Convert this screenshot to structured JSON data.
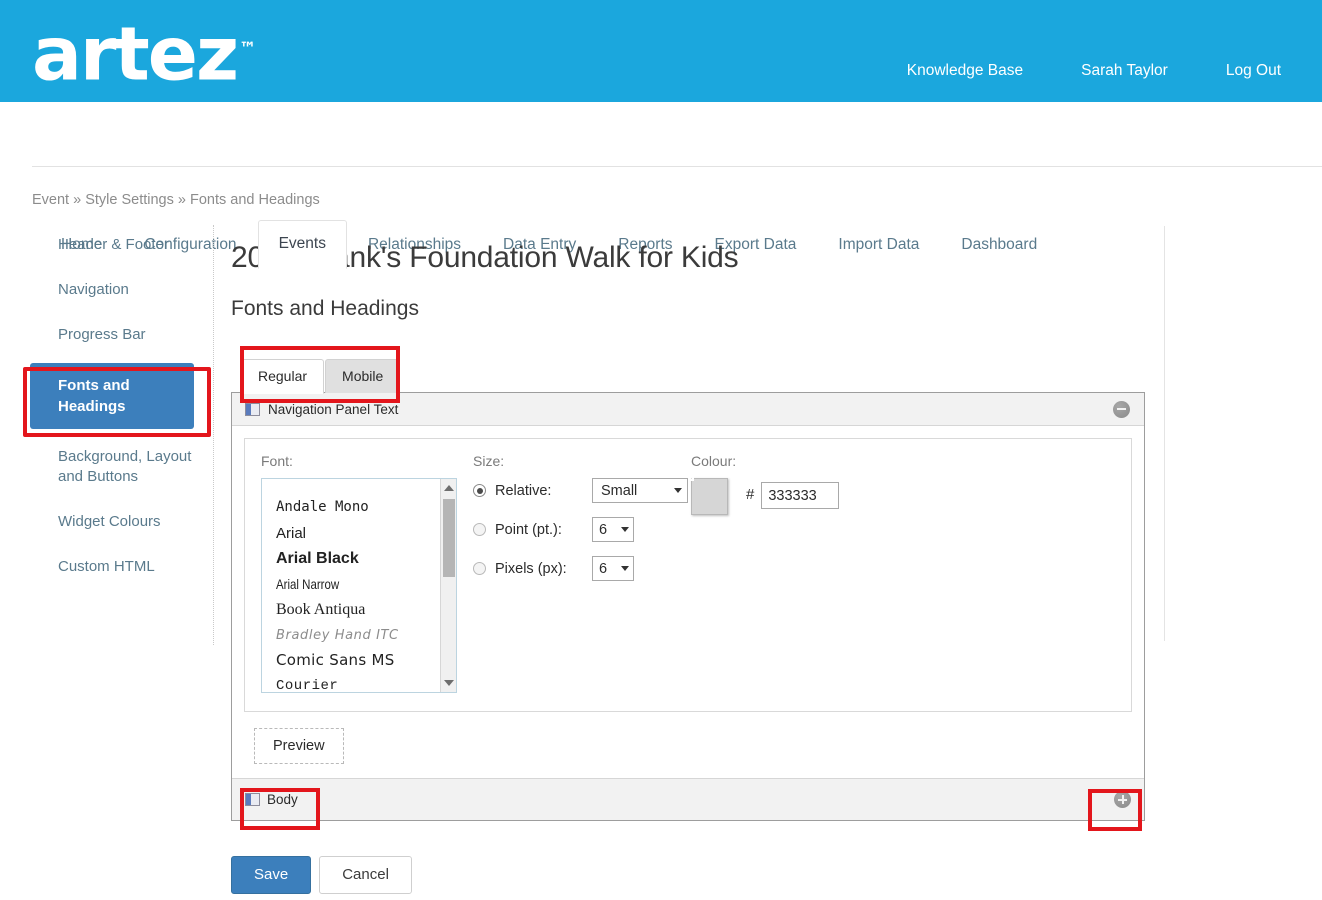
{
  "brand": {
    "logo_text": "artez",
    "logo_tm": "™",
    "links": [
      {
        "label": "Knowledge Base"
      },
      {
        "label": "Sarah Taylor"
      },
      {
        "label": "Log Out"
      }
    ],
    "header_color": "#1BA7DD"
  },
  "nav": {
    "tabs": [
      {
        "label": "Home",
        "active": false
      },
      {
        "label": "Configuration",
        "active": false
      },
      {
        "label": "Events",
        "active": true
      },
      {
        "label": "Relationships",
        "active": false
      },
      {
        "label": "Data Entry",
        "active": false
      },
      {
        "label": "Reports",
        "active": false
      },
      {
        "label": "Export Data",
        "active": false
      },
      {
        "label": "Import Data",
        "active": false
      },
      {
        "label": "Dashboard",
        "active": false
      }
    ]
  },
  "breadcrumb": {
    "text": "Event » Style Settings » Fonts and Headings"
  },
  "sidebar": {
    "items": [
      {
        "label": "Header & Footer",
        "active": false
      },
      {
        "label": "Navigation",
        "active": false
      },
      {
        "label": "Progress Bar",
        "active": false
      },
      {
        "label": "Fonts and Headings",
        "active": true
      },
      {
        "label": "Background, Layout and Buttons",
        "active": false
      },
      {
        "label": "Widget Colours",
        "active": false
      },
      {
        "label": "Custom HTML",
        "active": false
      }
    ],
    "active_color": "#3C7FBC"
  },
  "main": {
    "title": "2017 Frank's Foundation Walk for Kids",
    "subtitle": "Fonts and Headings",
    "view_tabs": [
      {
        "label": "Regular",
        "active": true
      },
      {
        "label": "Mobile",
        "active": false
      }
    ],
    "accordion": {
      "open_section": {
        "title": "Navigation Panel Text",
        "icon": "panel-icon",
        "toggle_icon": "minus-circle-icon"
      },
      "closed_section": {
        "title": "Body",
        "icon": "panel-icon",
        "toggle_icon": "plus-circle-icon"
      }
    },
    "font_field": {
      "label": "Font:",
      "options": [
        "Andale Mono",
        "Arial",
        "Arial Black",
        "Arial Narrow",
        "Book Antiqua",
        "Bradley Hand ITC",
        "Comic Sans MS",
        "Courier"
      ]
    },
    "size_field": {
      "label": "Size:",
      "rows": [
        {
          "label": "Relative:",
          "selected": true,
          "value": "Small"
        },
        {
          "label": "Point (pt.):",
          "selected": false,
          "value": "6"
        },
        {
          "label": "Pixels (px):",
          "selected": false,
          "value": "6"
        }
      ]
    },
    "colour_field": {
      "label": "Colour:",
      "hash": "#",
      "hex_value": "333333",
      "swatch_color": "#333333"
    },
    "preview_button": "Preview",
    "save_button": "Save",
    "cancel_button": "Cancel"
  },
  "annotations": {
    "color": "#E3161C",
    "boxes": [
      {
        "target": "sidebar-item-fonts-and-headings"
      },
      {
        "target": "view-tabs"
      },
      {
        "target": "accordion-body-section"
      },
      {
        "target": "accordion-add-button"
      }
    ]
  }
}
